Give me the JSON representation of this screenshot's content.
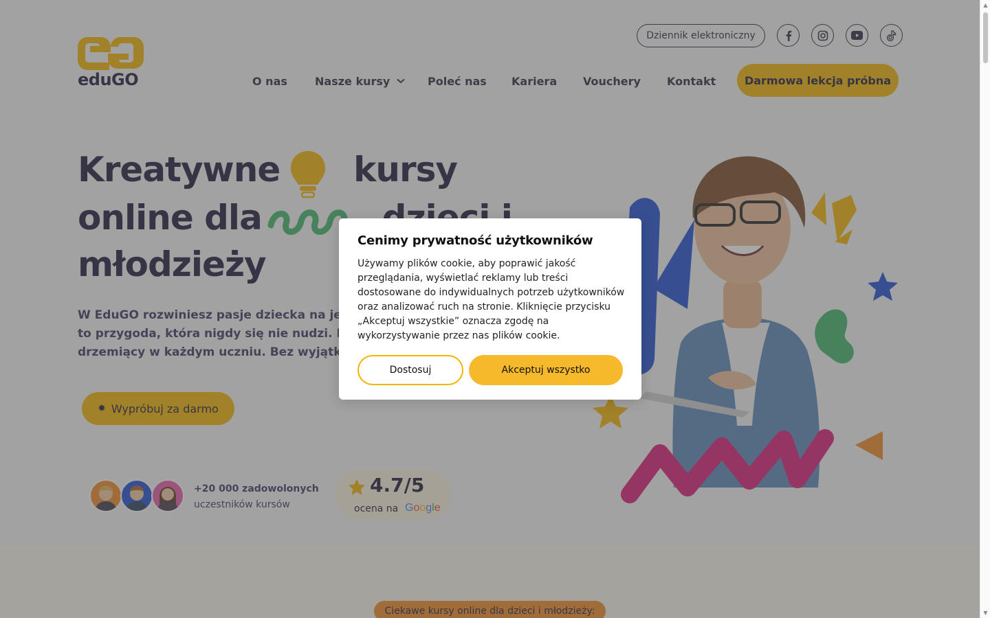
{
  "header": {
    "logo_text": "eduGO",
    "top_link": "Dziennik elektroniczny",
    "socials": [
      "facebook-icon",
      "instagram-icon",
      "youtube-icon",
      "tiktok-icon"
    ],
    "nav": [
      "O nas",
      "Nasze kursy",
      "Poleć nas",
      "Kariera",
      "Vouchery",
      "Kontakt"
    ],
    "cta": "Darmowa lekcja próbna"
  },
  "hero": {
    "line1_a": "Kreatywne",
    "line1_b": "kursy",
    "line2_a": "online dla",
    "line2_b": "dzieci i",
    "line3": "młodzieży",
    "lead_line1": "W EduGO rozwiniesz pasje dziecka na jego",
    "lead_line2": "to przygoda, która nigdy się nie nudzi. Poz",
    "lead_line3": "drzemiący w każdym uczniu. Bez wyjątku",
    "cta": "Wypróbuj za darmo",
    "users_count": "+20 000 zadowolonych",
    "users_sub": "uczestników kursów",
    "rating_value": "4.7/5",
    "rating_on": "ocena na",
    "rating_source": "Google"
  },
  "section2": {
    "badge": "Ciekawe kursy online dla dzieci i młodzieży:"
  },
  "cookie": {
    "title": "Cenimy prywatność użytkowników",
    "text": "Używamy plików cookie, aby poprawić jakość przeglądania, wyświetlać reklamy lub treści dostosowane do indywidualnych potrzeb użytkowników oraz analizować ruch na stronie. Kliknięcie przycisku „Akceptuj wszystkie” oznacza zgodę na wykorzystywanie przez nas plików cookie.",
    "customize": "Dostosuj",
    "accept": "Akceptuj wszystko"
  },
  "colors": {
    "accent": "#f4b400",
    "navy": "#1f1a3a",
    "badge": "#f08a24",
    "green": "#3fb56b",
    "blue": "#1f4fd1",
    "magenta": "#d81b78"
  }
}
